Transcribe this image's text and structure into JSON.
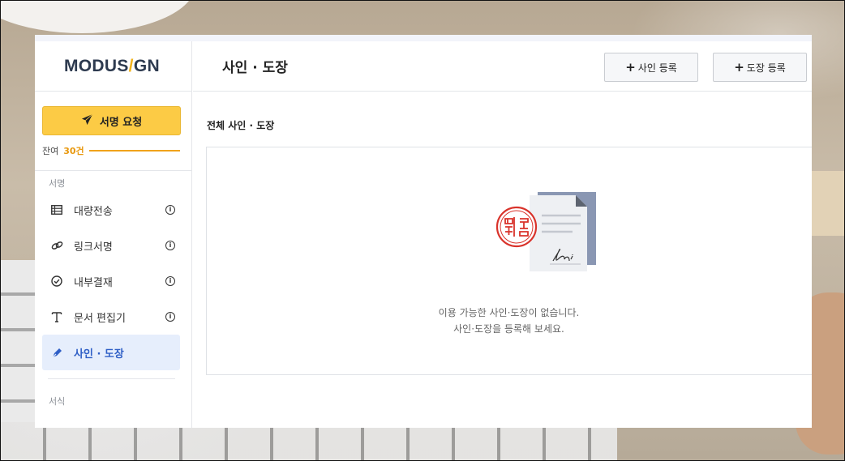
{
  "app": {
    "logo_left": "MODUS",
    "logo_slash": "/",
    "logo_right": "GN"
  },
  "sidebar": {
    "sign_request_label": "서명 요청",
    "remaining_prefix": "잔여",
    "remaining_count": "30건",
    "section_sign": "서명",
    "items": [
      {
        "label": "대량전송",
        "icon": "table-icon"
      },
      {
        "label": "링크서명",
        "icon": "link-icon"
      },
      {
        "label": "내부결재",
        "icon": "check-circle-icon"
      },
      {
        "label": "문서 편집기",
        "icon": "text-icon"
      },
      {
        "label": "사인 · 도장",
        "icon": "pen-icon"
      }
    ],
    "section_form": "서식"
  },
  "header": {
    "title": "사인 · 도장",
    "add_sign_label": "사인 등록",
    "add_stamp_label": "도장 등록"
  },
  "main": {
    "section_title": "전체 사인 · 도장",
    "empty_line1": "이용 가능한 사인·도장이 없습니다.",
    "empty_line2": "사인·도장을 등록해 보세요."
  },
  "colors": {
    "accent_yellow": "#fccb45",
    "active_blue": "#2f5fc6",
    "stamp_red": "#d9332b"
  }
}
